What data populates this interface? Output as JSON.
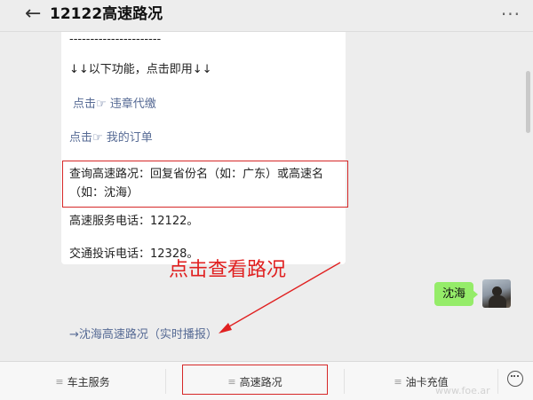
{
  "header": {
    "back_glyph": "←",
    "title": "12122高速路况",
    "more_glyph": "···"
  },
  "message": {
    "divider": "----------------------",
    "intro": "↓↓以下功能，点击即用↓↓",
    "link_violations": "点击☞ 违章代缴",
    "link_orders": "点击☞ 我的订单",
    "query_tip": "查询高速路况：回复省份名（如：广东）或高速名（如：沈海）",
    "service_phone": "高速服务电话：12122。",
    "complaint_phone": "交通投诉电话：12328。"
  },
  "annotation": {
    "text": "点击查看路况",
    "color": "#e02020"
  },
  "user_message": {
    "text": "沈海",
    "bubble_color": "#95ec69"
  },
  "reply_link": "→沈海高速路况（实时播报）",
  "menu": {
    "items": [
      "车主服务",
      "高速路况",
      "油卡充值"
    ],
    "icon_glyph": "≡"
  },
  "watermark": "www.foe.ar"
}
